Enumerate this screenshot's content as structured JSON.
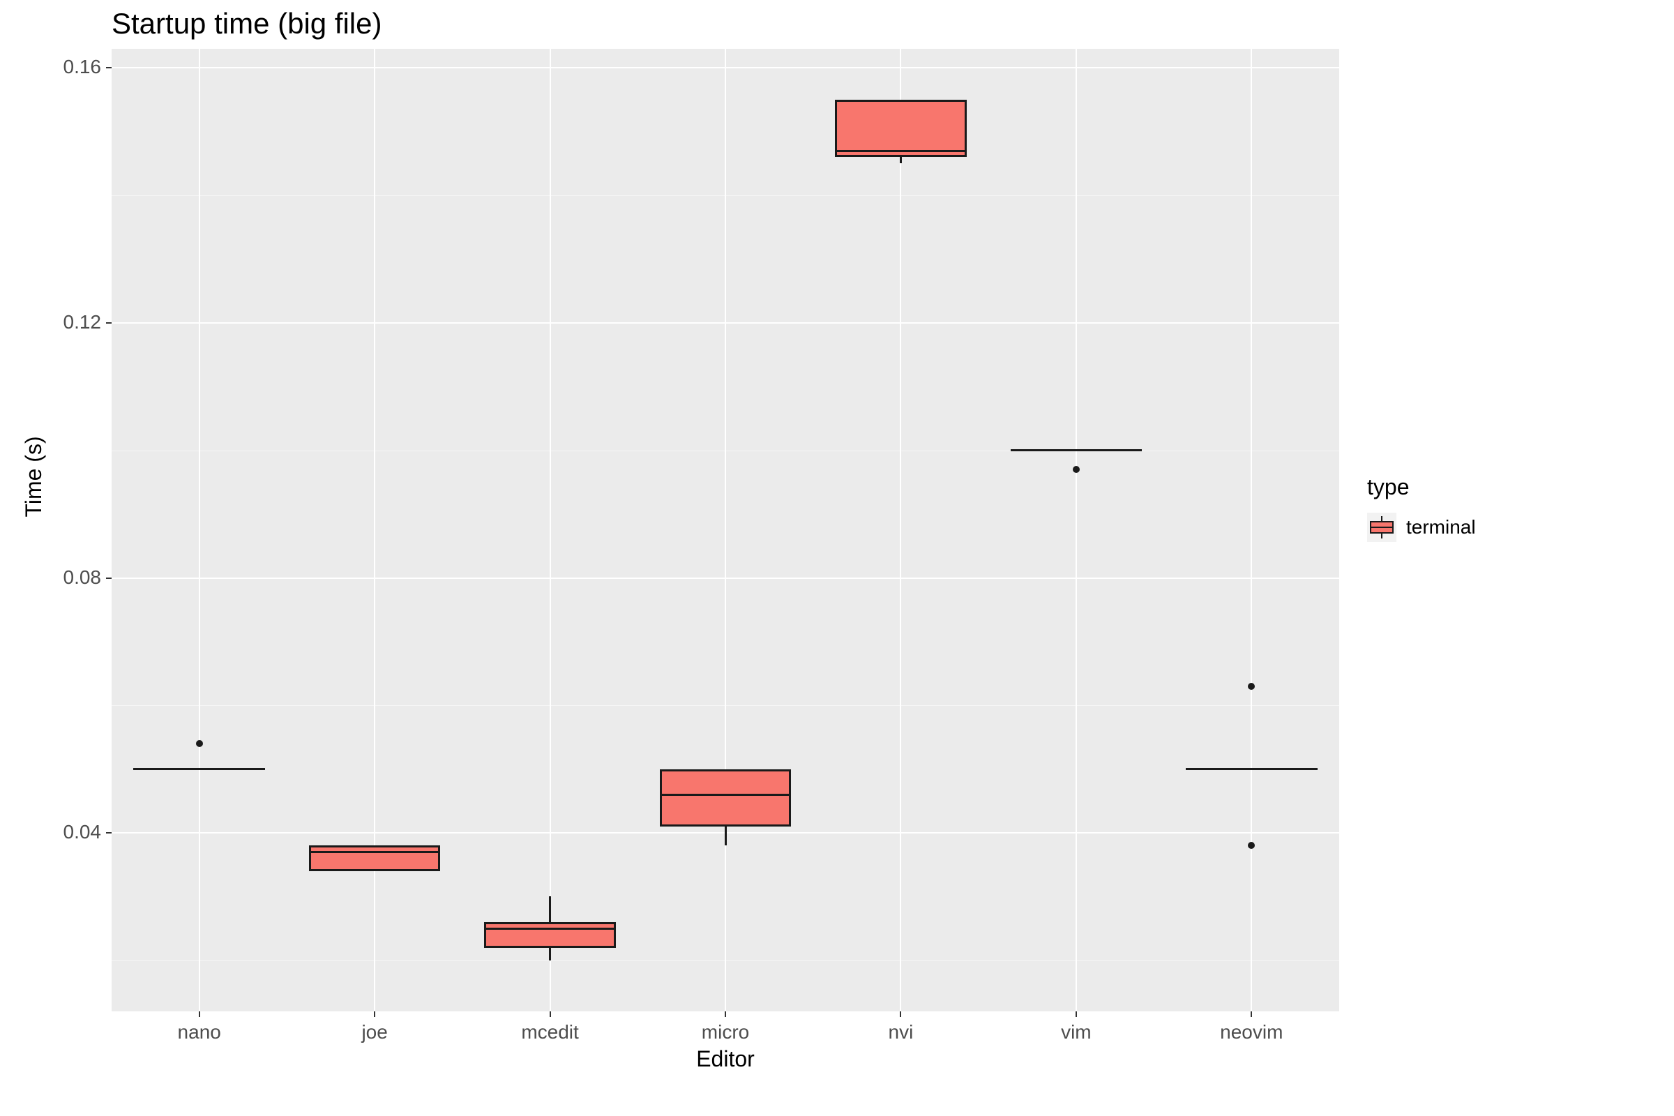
{
  "chart_data": {
    "type": "boxplot",
    "title": "Startup time (big file)",
    "xlabel": "Editor",
    "ylabel": "Time (s)",
    "ylim": [
      0.012,
      0.163
    ],
    "y_ticks": [
      0.04,
      0.08,
      0.12,
      0.16
    ],
    "categories": [
      "nano",
      "joe",
      "mcedit",
      "micro",
      "nvi",
      "vim",
      "neovim"
    ],
    "legend": {
      "title": "type",
      "entries": [
        "terminal"
      ]
    },
    "fill_color": "#f8766d",
    "series": [
      {
        "name": "terminal",
        "boxes": [
          {
            "category": "nano",
            "q1": 0.05,
            "median": 0.05,
            "q3": 0.05,
            "lower_whisker": 0.05,
            "upper_whisker": 0.05,
            "outliers": [
              0.054
            ]
          },
          {
            "category": "joe",
            "q1": 0.034,
            "median": 0.037,
            "q3": 0.038,
            "lower_whisker": 0.034,
            "upper_whisker": 0.038,
            "outliers": []
          },
          {
            "category": "mcedit",
            "q1": 0.022,
            "median": 0.025,
            "q3": 0.026,
            "lower_whisker": 0.02,
            "upper_whisker": 0.03,
            "outliers": []
          },
          {
            "category": "micro",
            "q1": 0.041,
            "median": 0.046,
            "q3": 0.05,
            "lower_whisker": 0.038,
            "upper_whisker": 0.05,
            "outliers": []
          },
          {
            "category": "nvi",
            "q1": 0.146,
            "median": 0.147,
            "q3": 0.155,
            "lower_whisker": 0.145,
            "upper_whisker": 0.155,
            "outliers": []
          },
          {
            "category": "vim",
            "q1": 0.1,
            "median": 0.1,
            "q3": 0.1,
            "lower_whisker": 0.1,
            "upper_whisker": 0.1,
            "outliers": [
              0.097
            ]
          },
          {
            "category": "neovim",
            "q1": 0.05,
            "median": 0.05,
            "q3": 0.05,
            "lower_whisker": 0.05,
            "upper_whisker": 0.05,
            "outliers": [
              0.038,
              0.063
            ]
          }
        ]
      }
    ]
  }
}
